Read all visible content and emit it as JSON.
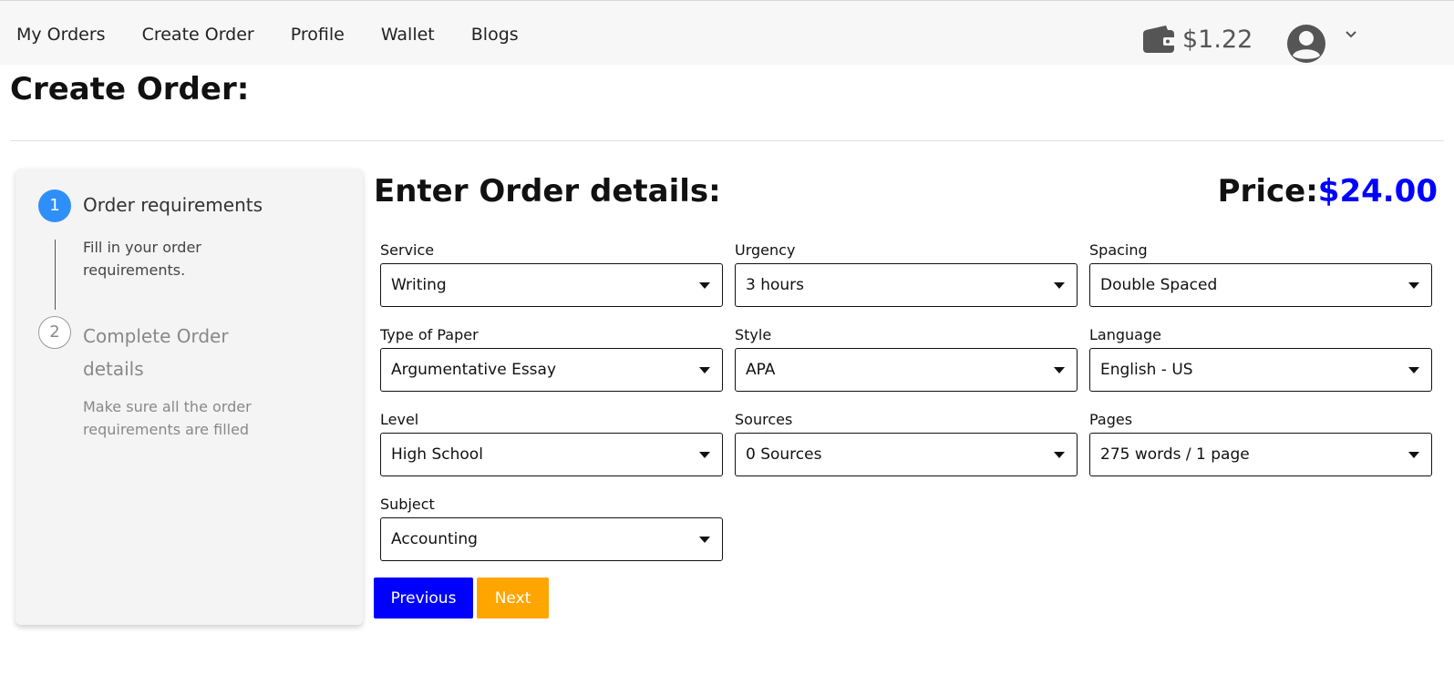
{
  "nav": {
    "items": [
      "My Orders",
      "Create Order",
      "Profile",
      "Wallet",
      "Blogs"
    ]
  },
  "wallet": {
    "icon": "wallet-icon",
    "balance": "$1.22"
  },
  "user_menu": {
    "avatar_icon": "user-avatar-icon",
    "chevron_icon": "chevron-down-icon"
  },
  "page": {
    "title": "Create Order:"
  },
  "stepper": {
    "steps": [
      {
        "number": "1",
        "title": "Order requirements",
        "description": "Fill in your order requirements.",
        "active": true
      },
      {
        "number": "2",
        "title": "Complete Order details",
        "description": "Make sure all the order requirements are filled",
        "active": false
      }
    ]
  },
  "form": {
    "title": "Enter Order details:",
    "price_label": "Price:",
    "price_value": "$24.00",
    "fields": {
      "service": {
        "label": "Service",
        "value": "Writing"
      },
      "urgency": {
        "label": "Urgency",
        "value": "3 hours"
      },
      "spacing": {
        "label": "Spacing",
        "value": "Double Spaced"
      },
      "paper_type": {
        "label": "Type of Paper",
        "value": "Argumentative Essay"
      },
      "style": {
        "label": "Style",
        "value": "APA"
      },
      "language": {
        "label": "Language",
        "value": "English - US"
      },
      "level": {
        "label": "Level",
        "value": "High School"
      },
      "sources": {
        "label": "Sources",
        "value": "0 Sources"
      },
      "pages": {
        "label": "Pages",
        "value": "275 words / 1 page"
      },
      "subject": {
        "label": "Subject",
        "value": "Accounting"
      }
    },
    "buttons": {
      "previous": "Previous",
      "next": "Next"
    }
  },
  "colors": {
    "accent_blue": "#0000ff",
    "step_active": "#2f8ff8",
    "next_orange": "#ffa500"
  }
}
